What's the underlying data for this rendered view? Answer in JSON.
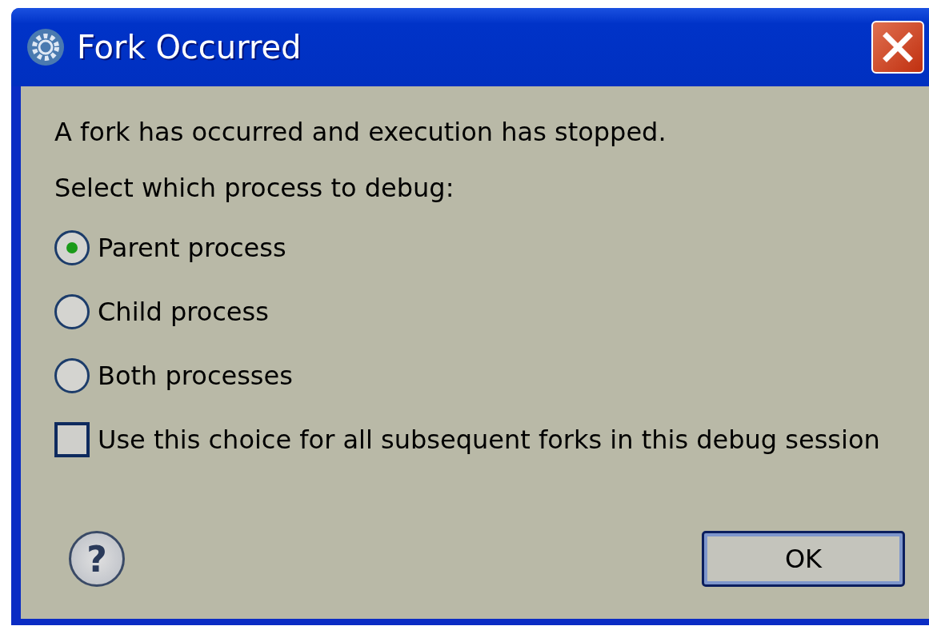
{
  "window": {
    "title": "Fork Occurred"
  },
  "message": "A fork has occurred and execution has stopped.",
  "prompt": "Select which process to debug:",
  "options": [
    {
      "label": "Parent process",
      "selected": true
    },
    {
      "label": "Child process",
      "selected": false
    },
    {
      "label": "Both processes",
      "selected": false
    }
  ],
  "remember": {
    "label": "Use this choice for all subsequent forks in this debug session",
    "checked": false
  },
  "help": {
    "label": "?"
  },
  "buttons": [
    "OK"
  ]
}
